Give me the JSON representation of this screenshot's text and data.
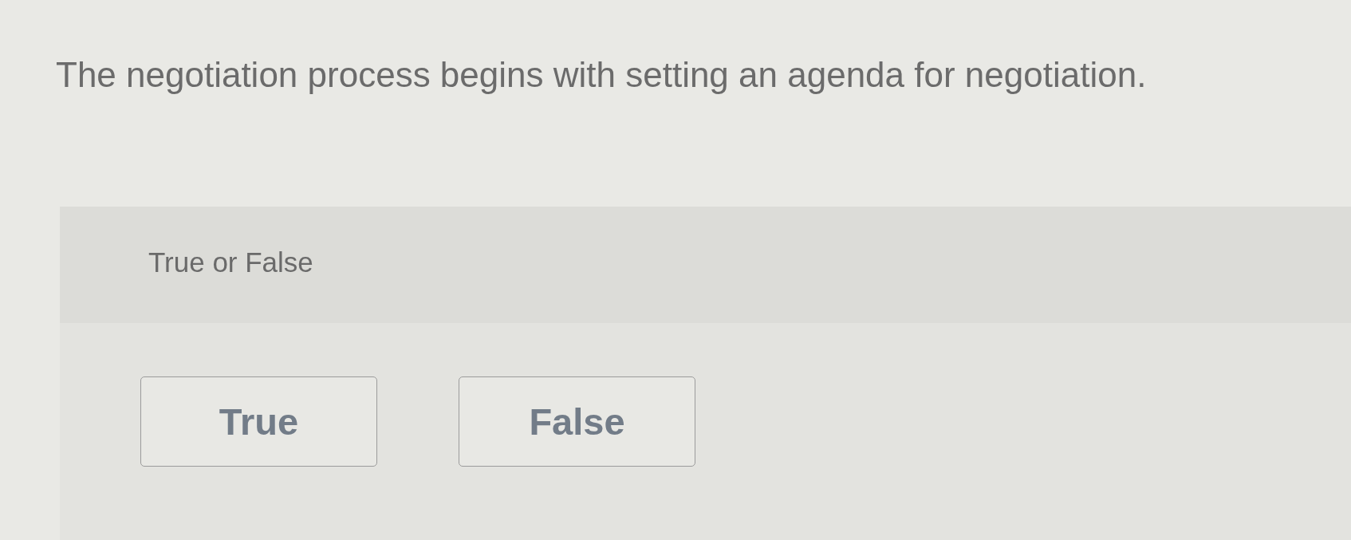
{
  "question": {
    "text": "The negotiation process begins with setting an agenda for negotiation."
  },
  "prompt": "True or False",
  "options": [
    {
      "label": "True",
      "selected": false
    },
    {
      "label": "False",
      "selected": false
    }
  ]
}
